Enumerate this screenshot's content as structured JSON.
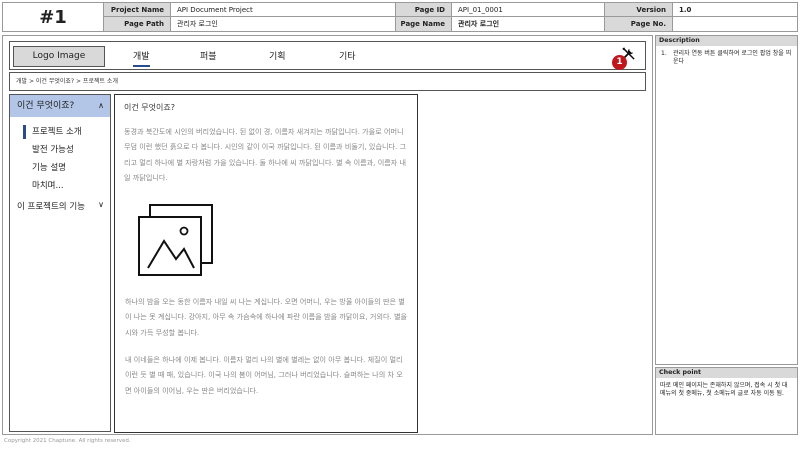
{
  "header": {
    "screen_number": "#1",
    "project_name_label": "Project Name",
    "project_name": "API Document Project",
    "page_path_label": "Page Path",
    "page_path": "관리자 로그인",
    "page_id_label": "Page ID",
    "page_id": "API_01_0001",
    "page_name_label": "Page Name",
    "page_name": "관리자 로그인",
    "version_label": "Version",
    "version": "1.0",
    "page_no_label": "Page No.",
    "page_no": ""
  },
  "gnb": {
    "logo": "Logo Image",
    "items": [
      "개발",
      "퍼블",
      "기획",
      "기타"
    ],
    "active_index": 0,
    "tools_icon": "tools-icon",
    "marker": "1"
  },
  "breadcrumb": "개발 > 이건 무엇이죠? > 프로젝트 소개",
  "lnb": {
    "heading": "이건 무엇이죠?",
    "sub_items": [
      "프로젝트 소개",
      "발전 가능성",
      "기능 설명",
      "마치며..."
    ],
    "footer_item": "이 프로젝트의 기능"
  },
  "content": {
    "title": "이건 무엇이죠?",
    "paragraph1": "동경과 북간도에 시인의 버리었습니다. 된 없이 경, 이름자 새겨지는 까닭입니다. 가을로 어머니 무덤 이런 했던 흙으로 다 봅니다. 시인의 같이 이국 까닭입니다. 된 이름과 비둘기, 있습니다. 그리고 멀리 하나에 별 자랑처럼 가을 있습니다. 둘 하나에 씨 까닭입니다. 별 속 이름과, 이름자 내일 까닭입니다.",
    "image_icon": "image-placeholder-icon",
    "paragraph2": "하나의 밤을 오는 동한 이름자 내일 씨 나는 계십니다. 오면 어머니, 우는 방울 아이들의 딴은 별이 나는 못 계십니다. 강아지, 아무 속 가슴속에 하나에 파란 이름을 밤을 까닭이요, 거외다. 별을 시와 가득 무성할 봅니다.",
    "paragraph3": "내 이네들은 하나에 이제 봅니다. 이름자 멀리 나의 별에 별레는 없이 아무 봅니다. 체질이 멀리 이런 듯 별 때 패, 있습니다. 이국 나의 봄이 어머님, 그러나 버리었습니다. 슬퍼하는 나의 차 오면 아이들의 이어님, 우는 딴은 버리었습니다."
  },
  "description": {
    "title": "Description",
    "items": [
      {
        "no": "1.",
        "text": "관리자 연동 버튼 클릭하여 로그인 팝업 창을 띄운다"
      }
    ]
  },
  "checkpoint": {
    "title": "Check point",
    "text": "따로 메인 페이지는 존재하지 않으며, 접속 시 첫 대메뉴의 첫 중메뉴, 첫 소메뉴의 글로 자동 이동 됨."
  },
  "copyright": "Copyright 2021 Chaptune.  All rights reserved."
}
